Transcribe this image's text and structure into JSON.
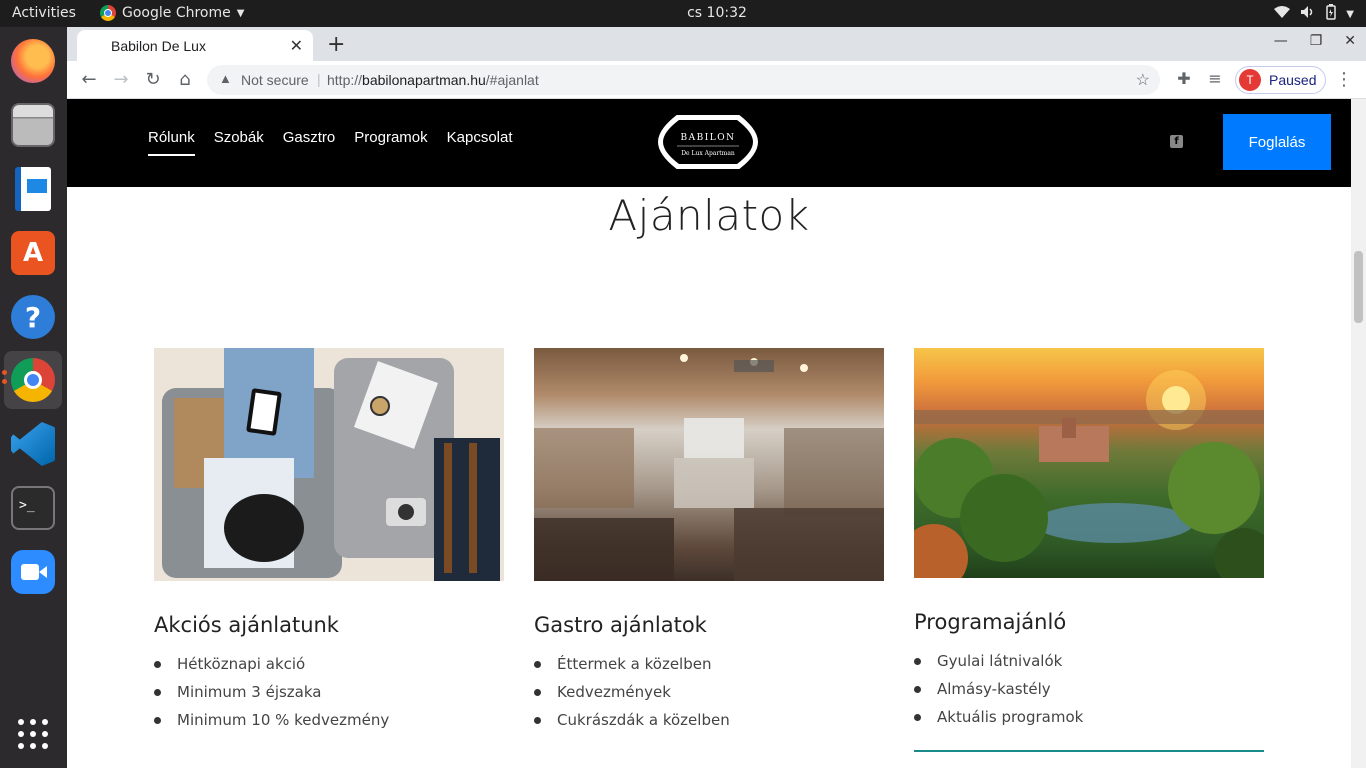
{
  "topbar": {
    "activities": "Activities",
    "app_name": "Google Chrome",
    "clock": "cs 10:32"
  },
  "dock": {
    "items": [
      "firefox-icon",
      "files-icon",
      "writer-icon",
      "software-icon",
      "help-icon",
      "chrome-icon",
      "vscode-icon",
      "terminal-icon",
      "zoom-icon",
      "apps-grid-icon"
    ]
  },
  "browser": {
    "tab_title": "Babilon De Lux",
    "omnibox": {
      "security": "Not secure",
      "url_prefix": "http://",
      "url_host": "babilonapartman.hu",
      "url_path": "/#ajanlat"
    },
    "profile_initial": "T",
    "profile_status": "Paused"
  },
  "site": {
    "nav": [
      "Rólunk",
      "Szobák",
      "Gasztro",
      "Programok",
      "Kapcsolat"
    ],
    "logo_top": "BABILON",
    "logo_bottom": "De Lux Apartman",
    "booking_button": "Foglalás",
    "heading": "Ajánlatok",
    "cards": [
      {
        "title": "Akciós ajánlatunk",
        "items": [
          "Hétköznapi akció",
          "Minimum 3 éjszaka",
          "Minimum 10 % kedvezmény"
        ]
      },
      {
        "title": "Gastro ajánlatok",
        "items": [
          "Éttermek a közelben",
          "Kedvezmények",
          "Cukrászdák a közelben"
        ]
      },
      {
        "title": "Programajánló",
        "items": [
          "Gyulai látnivalók",
          "Almásy-kastély",
          "Aktuális programok"
        ]
      }
    ]
  },
  "colors": {
    "nav_bg": "#000000",
    "booking_bg": "#007bff",
    "dock_bg": "#2c2a2d",
    "topbar_bg": "#1d1d1d"
  }
}
